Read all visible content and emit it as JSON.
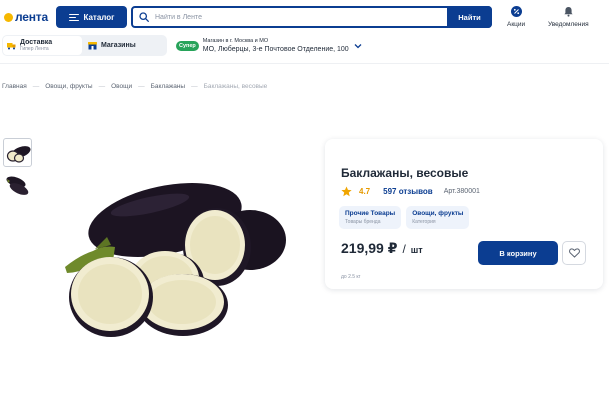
{
  "header": {
    "logo_text": "лента",
    "catalog_label": "Каталог",
    "search": {
      "placeholder": "Найти в Ленте",
      "button_label": "Найти"
    },
    "actions": [
      {
        "label": "Акции",
        "icon": "percent-icon"
      },
      {
        "label": "Уведомления",
        "icon": "bell-icon"
      }
    ],
    "delivery": {
      "active": {
        "title": "Доставка",
        "subtitle": "Гипер Лента",
        "icon": "truck-icon"
      },
      "inactive": {
        "title": "Магазины",
        "icon": "store-icon"
      }
    },
    "store": {
      "badge": "Супер",
      "title": "Магазин в г. Москва и МО",
      "address": "МО, Люберцы, 3-е Почтовое Отделение, 100"
    }
  },
  "breadcrumbs": [
    "Главная",
    "Овощи, фрукты",
    "Овощи",
    "Баклажаны",
    "Баклажаны, весовые"
  ],
  "product": {
    "title": "Баклажаны, весовые",
    "rating": "4.7",
    "reviews": "597 отзывов",
    "sku": "Арт.380001",
    "chips": [
      {
        "title": "Прочие Товары",
        "subtitle": "Товары бренда"
      },
      {
        "title": "Овощи, фрукты",
        "subtitle": "Категория"
      }
    ],
    "price": "219,99 ₽",
    "price_separator": "/",
    "unit": "шт",
    "cart_label": "В корзину",
    "weight_note": "до 2.5 кг"
  },
  "colors": {
    "brand_blue": "#0b3d91",
    "brand_yellow": "#f6b800",
    "badge_green": "#27a35a",
    "rating_orange": "#e69a00"
  }
}
